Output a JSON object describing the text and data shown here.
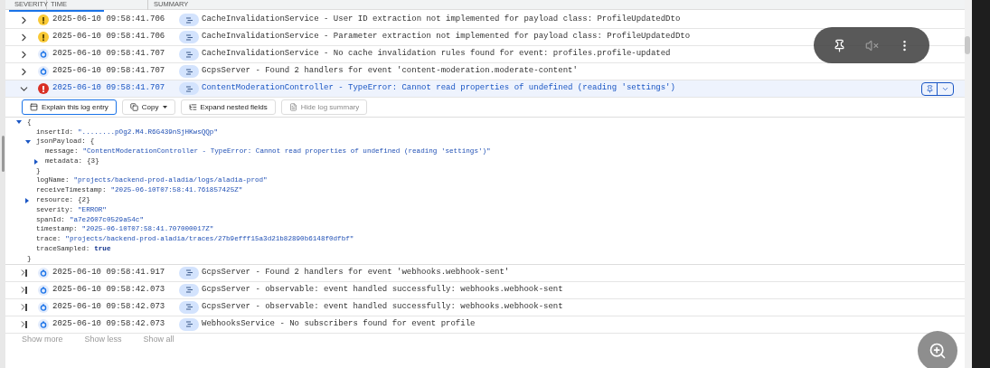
{
  "table": {
    "columns": [
      "SEVERITY",
      "TIME",
      "SUMMARY"
    ],
    "rows_before": [
      {
        "streamed": false,
        "expanded": false,
        "kind": "warning",
        "time": "2025-06-10 09:58:41.706",
        "summary": "CacheInvalidationService - User ID extraction not implemented for payload class: ProfileUpdatedDto"
      },
      {
        "streamed": false,
        "expanded": false,
        "kind": "warning",
        "time": "2025-06-10 09:58:41.706",
        "summary": "CacheInvalidationService - Parameter extraction not implemented for payload class: ProfileUpdatedDto"
      },
      {
        "streamed": false,
        "expanded": false,
        "kind": "debug",
        "time": "2025-06-10 09:58:41.707",
        "summary": "CacheInvalidationService - No cache invalidation rules found for event: profiles.profile-updated"
      },
      {
        "streamed": false,
        "expanded": false,
        "kind": "debug",
        "time": "2025-06-10 09:58:41.707",
        "summary": "GcpsServer - Found 2 handlers for event 'content-moderation.moderate-content'"
      },
      {
        "streamed": false,
        "expanded": true,
        "kind": "error",
        "time": "2025-06-10 09:58:41.707",
        "summary": "ContentModerationController - TypeError: Cannot read properties of undefined (reading 'settings')"
      }
    ],
    "actions": [
      {
        "kind": "explain",
        "label": "Explain this log entry",
        "disabled": false,
        "focused": true
      },
      {
        "kind": "copy",
        "label": "Copy",
        "disabled": false,
        "focused": false
      },
      {
        "kind": "expand",
        "label": "Expand nested fields",
        "disabled": false,
        "focused": false
      },
      {
        "kind": "hide",
        "label": "Hide log summary",
        "disabled": true,
        "focused": false
      }
    ],
    "payload": {
      "open": "{",
      "expanded": true,
      "close": "}",
      "children": [
        {
          "key": "insertId:",
          "value": "\"........pOg2.M4.R6G439nSjHKwsQQp\"",
          "kind": "string"
        },
        {
          "key": "jsonPayload:",
          "open": "{",
          "expanded": true,
          "close": "}",
          "children": [
            {
              "key": "message:",
              "value": "\"ContentModerationController - TypeError: Cannot read properties of undefined (reading 'settings')\"",
              "kind": "string"
            },
            {
              "key": "metadata:",
              "open": "{3}",
              "expanded": false
            }
          ]
        },
        {
          "key": "logName:",
          "value": "\"projects/backend-prod-aladia/logs/aladia-prod\"",
          "kind": "string"
        },
        {
          "key": "receiveTimestamp:",
          "value": "\"2025-06-10T07:58:41.761857425Z\"",
          "kind": "string"
        },
        {
          "key": "resource:",
          "open": "{2}",
          "expanded": false
        },
        {
          "key": "severity:",
          "value": "\"ERROR\"",
          "kind": "string"
        },
        {
          "key": "spanId:",
          "value": "\"a7e2607c0529a54c\"",
          "kind": "string"
        },
        {
          "key": "timestamp:",
          "value": "\"2025-06-10T07:58:41.707000017Z\"",
          "kind": "string"
        },
        {
          "key": "trace:",
          "value": "\"projects/backend-prod-aladia/traces/27b9efff15a3d21b82890b6148f0dfbf\"",
          "kind": "string"
        },
        {
          "key": "traceSampled:",
          "value": "true",
          "kind": "boolean"
        }
      ]
    },
    "rows_after": [
      {
        "streamed": true,
        "expanded": false,
        "kind": "debug",
        "time": "2025-06-10 09:58:41.917",
        "summary": "GcpsServer - Found 2 handlers for event 'webhooks.webhook-sent'"
      },
      {
        "streamed": true,
        "expanded": false,
        "kind": "debug",
        "time": "2025-06-10 09:58:42.073",
        "summary": "GcpsServer - observable: event handled successfully: webhooks.webhook-sent"
      },
      {
        "streamed": true,
        "expanded": false,
        "kind": "debug",
        "time": "2025-06-10 09:58:42.073",
        "summary": "GcpsServer - observable: event handled successfully: webhooks.webhook-sent"
      },
      {
        "streamed": true,
        "expanded": false,
        "kind": "debug",
        "time": "2025-06-10 09:58:42.073",
        "summary": "WebhooksService - No subscribers found for event profile"
      }
    ],
    "footer": [
      "Show more",
      "Show less",
      "Show all"
    ]
  }
}
